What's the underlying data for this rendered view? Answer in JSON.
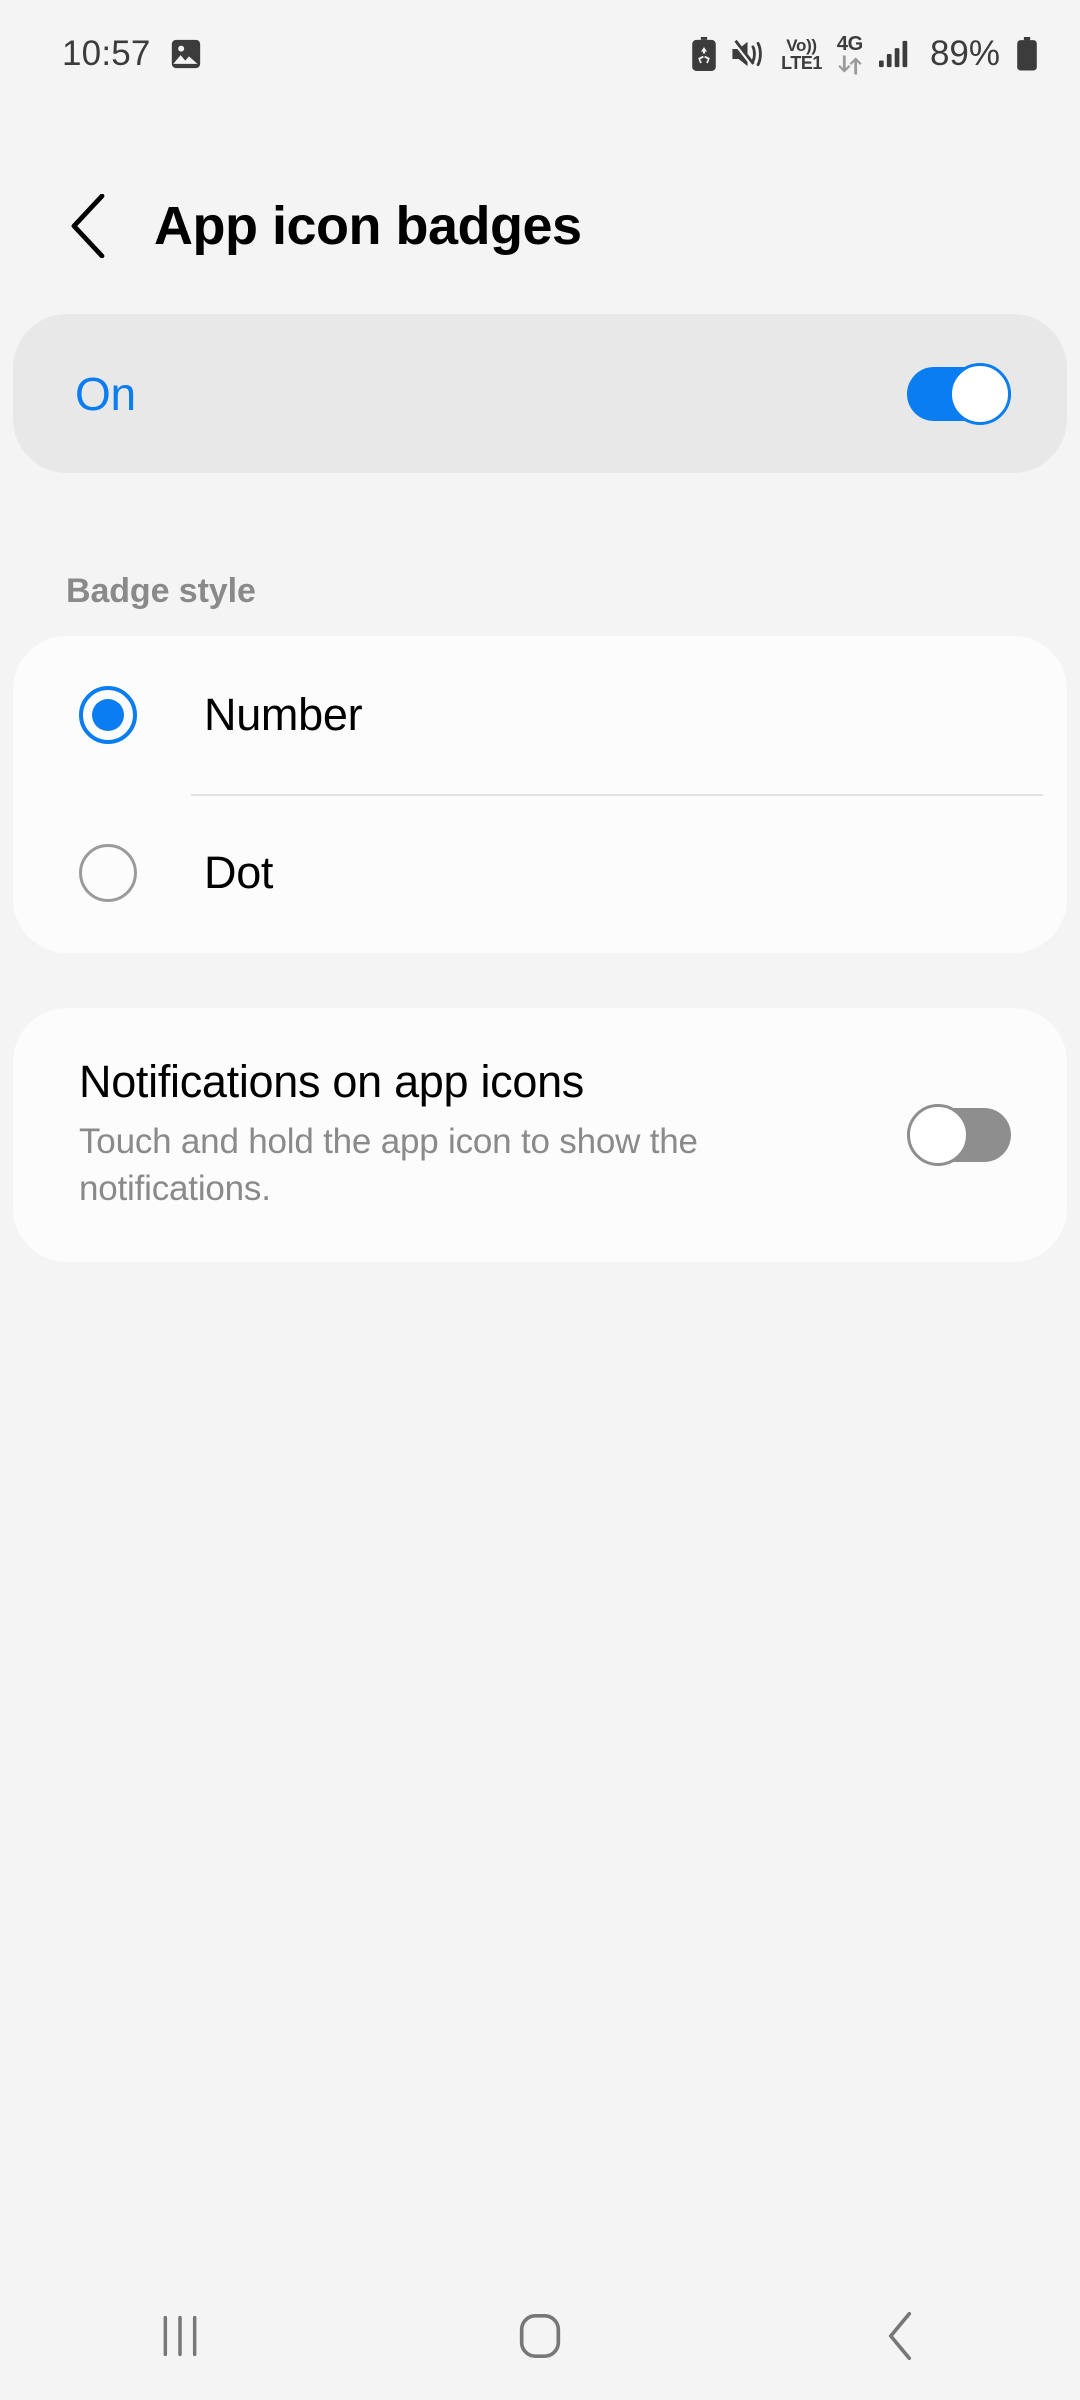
{
  "status_bar": {
    "clock": "10:57",
    "left_icons": [
      {
        "name": "gallery-icon",
        "label": "gallery"
      }
    ],
    "right_icons": [
      {
        "name": "battery-saver-icon",
        "label": "battery saver"
      },
      {
        "name": "mute-vibrate-icon",
        "label": "sound off"
      }
    ],
    "volte_top": "Vo))",
    "volte_bottom": "LTE1",
    "network_type": "4G",
    "data_arrows": "↓↑",
    "signal_label": "signal bars",
    "battery_percent": "89%"
  },
  "header": {
    "back_label": "Back",
    "title": "App icon badges"
  },
  "master_switch": {
    "label": "On",
    "state": "on",
    "accent_color": "#0a7ef0"
  },
  "badge_style": {
    "section_label": "Badge style",
    "options": [
      {
        "label": "Number",
        "selected": true
      },
      {
        "label": "Dot",
        "selected": false
      }
    ]
  },
  "notifications_on_app_icons": {
    "title": "Notifications on app icons",
    "description": "Touch and hold the app icon to show the notifications.",
    "state": "off",
    "off_color": "#8e8e8e"
  },
  "nav_bar": {
    "recents_label": "Recents",
    "home_label": "Home",
    "back_label": "Back"
  },
  "colors": {
    "page_background": "#f4f4f4",
    "card_background": "#fcfcfc",
    "master_card_background": "#e8e8e8",
    "accent": "#0a7ef0",
    "secondary_text": "#8a8a8a"
  }
}
